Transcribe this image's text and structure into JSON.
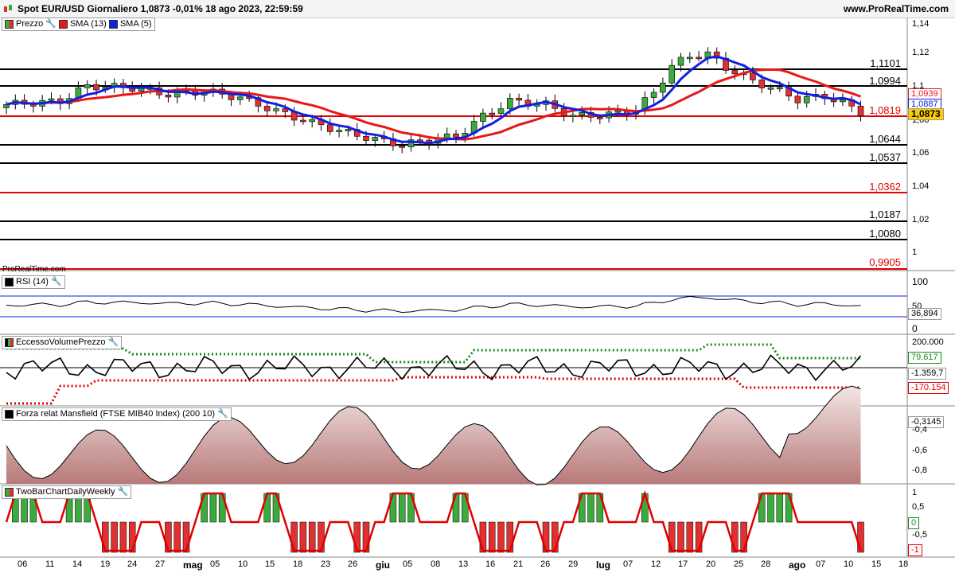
{
  "header": {
    "title": "Spot EUR/USD Giornaliero 1,0873 -0,01% 18 ago 2023, 22:59:59",
    "site": "www.ProRealTime.com"
  },
  "price_panel": {
    "legend": {
      "price": "Prezzo",
      "sma13": "SMA (13)",
      "sma5": "SMA (5)"
    },
    "watermark": "ProRealTime.com",
    "axis_ticks": [
      "1,14",
      "1,12",
      "1,1",
      "1,08",
      "1,06",
      "1,04",
      "1,02",
      "1"
    ],
    "levels": [
      {
        "label": "1,1101",
        "color": "#000000"
      },
      {
        "label": "1,0994",
        "color": "#000000"
      },
      {
        "label": "1,0819",
        "color": "#e00000"
      },
      {
        "label": "1,0644",
        "color": "#000000"
      },
      {
        "label": "1,0537",
        "color": "#000000"
      },
      {
        "label": "1,0362",
        "color": "#e00000"
      },
      {
        "label": "1,0187",
        "color": "#000000"
      },
      {
        "label": "1,0080",
        "color": "#000000"
      },
      {
        "label": "0,9905",
        "color": "#e00000"
      }
    ],
    "tags": {
      "sma13": "1,0939",
      "sma5": "1,0887",
      "last": "1,0873"
    }
  },
  "rsi_panel": {
    "label": "RSI (14)",
    "ticks": [
      "100",
      "50",
      "0"
    ],
    "value": "36,894"
  },
  "evp_panel": {
    "label": "EccessoVolumePrezzo",
    "ticks": [
      "200.000"
    ],
    "upper": "79.617",
    "mid": "-1.359,7",
    "lower": "-170.154"
  },
  "mansfield_panel": {
    "label": "Forza relat Mansfield (FTSE MIB40 Index) (200 10)",
    "ticks": [
      "-0,4",
      "-0,6",
      "-0,8"
    ],
    "value": "-0,3145"
  },
  "twobar_panel": {
    "label": "TwoBarChartDailyWeekly",
    "ticks": [
      "1",
      "0,5",
      "-0,5"
    ],
    "zero": "0",
    "minus": "-1"
  },
  "x_axis": [
    "06",
    "11",
    "14",
    "19",
    "24",
    "27",
    "mag",
    "05",
    "10",
    "15",
    "18",
    "23",
    "26",
    "giu",
    "05",
    "08",
    "13",
    "16",
    "21",
    "26",
    "29",
    "lug",
    "07",
    "12",
    "17",
    "20",
    "25",
    "28",
    "ago",
    "07",
    "10",
    "15",
    "18"
  ],
  "colors": {
    "up": "#3daa3d",
    "down": "#e03030",
    "sma13": "#e81818",
    "sma5": "#1020e0",
    "accent": "#ffcc00"
  }
}
